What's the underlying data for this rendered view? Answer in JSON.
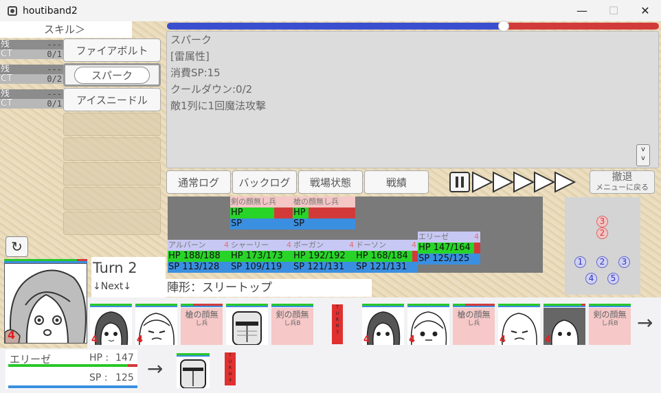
{
  "window": {
    "title": "houtiband2",
    "minimize": "—",
    "maximize": "☐",
    "close": "✕"
  },
  "skills": {
    "header": "スキル＞",
    "items": [
      {
        "remain_label": "残",
        "remain": "---",
        "ct_label": "CT",
        "ct": "0/1",
        "name": "ファイアボルト"
      },
      {
        "remain_label": "残",
        "remain": "---",
        "ct_label": "CT",
        "ct": "0/2",
        "name": "スパーク"
      },
      {
        "remain_label": "残",
        "remain": "---",
        "ct_label": "CT",
        "ct": "0/1",
        "name": "アイスニードル"
      }
    ],
    "selected": 1
  },
  "progress_fraction": 0.685,
  "description": {
    "lines": [
      "スパーク",
      "[雷属性]",
      "消費SP:15",
      "クールダウン:0/2",
      "敵1列に1回魔法攻撃"
    ],
    "scroll_label": "v\nv"
  },
  "tabs": {
    "normal_log": "通常ログ",
    "back_log": "バックログ",
    "battlefield": "戦場状態",
    "record": "戦績"
  },
  "retreat": {
    "label": "撤退",
    "sub": "メニューに戻る"
  },
  "units": {
    "enemies": [
      {
        "name": "剣の顔無し兵",
        "hp_label": "HP",
        "sp_label": "SP",
        "num": "",
        "hp_frac": 0.7
      },
      {
        "name": "槍の顔無し兵",
        "hp_label": "HP",
        "sp_label": "SP",
        "num": "",
        "hp_frac": 0.25
      }
    ],
    "allies": [
      {
        "name": "アルバーン",
        "num": "4",
        "hp_label": "HP",
        "hp": "188/188",
        "sp_label": "SP",
        "sp": "113/128",
        "hp_frac": 1.0
      },
      {
        "name": "シャーリー",
        "num": "4",
        "hp_label": "HP",
        "hp": "173/173",
        "sp_label": "SP",
        "sp": "109/119",
        "hp_frac": 1.0
      },
      {
        "name": "ボーガン",
        "num": "4",
        "hp_label": "HP",
        "hp": "192/192",
        "sp_label": "SP",
        "sp": "121/131",
        "hp_frac": 1.0
      },
      {
        "name": "ドーソン",
        "num": "4",
        "hp_label": "HP",
        "hp": "168/184",
        "sp_label": "SP",
        "sp": "121/131",
        "hp_frac": 0.91
      },
      {
        "name": "エリーゼ",
        "num": "4",
        "hp_label": "HP",
        "hp": "147/164",
        "sp_label": "SP",
        "sp": "125/125",
        "hp_frac": 0.9
      }
    ]
  },
  "formation_map": {
    "enemy": [
      "3",
      "2"
    ],
    "ally": [
      "1",
      "2",
      "3",
      "4",
      "5"
    ]
  },
  "turn": {
    "label": "Turn 2",
    "next": "↓Next↓"
  },
  "formation": "陣形：スリートップ",
  "queue": {
    "cards": [
      {
        "type": "ally",
        "num": "4"
      },
      {
        "type": "ally",
        "num": "4"
      },
      {
        "type": "enemy",
        "name": "槍の顔無",
        "sub": "し兵"
      },
      {
        "type": "ally",
        "num": ""
      },
      {
        "type": "enemy",
        "name": "剣の顔無",
        "sub": "し兵B"
      },
      {
        "type": "ally",
        "num": "4"
      },
      {
        "type": "ally",
        "num": "4"
      },
      {
        "type": "enemy",
        "name": "槍の顔無",
        "sub": "し兵"
      },
      {
        "type": "ally",
        "num": "4"
      },
      {
        "type": "ally",
        "num": "4"
      },
      {
        "type": "enemy",
        "name": "剣の顔無",
        "sub": "し兵B"
      }
    ],
    "turn_marker": "TURN3",
    "turn_marker2": "TURN4",
    "arrow": "→"
  },
  "current": {
    "name": "エリーゼ",
    "hp_label": "HP :",
    "hp": "147",
    "sp_label": "SP :",
    "sp": "125",
    "portrait_num": "4"
  }
}
